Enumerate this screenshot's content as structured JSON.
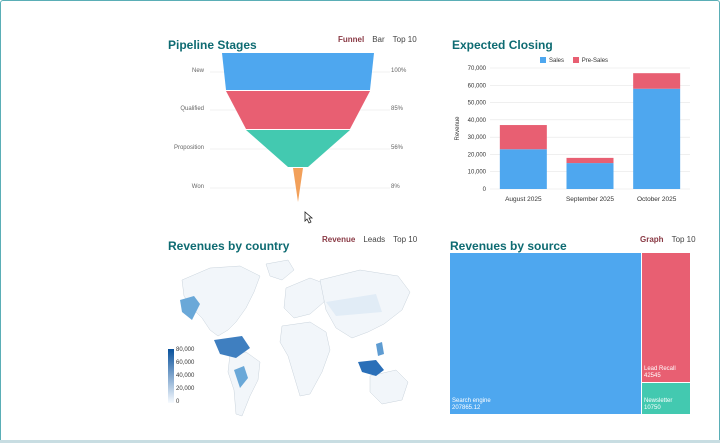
{
  "funnel": {
    "title": "Pipeline Stages",
    "tabs": [
      "Funnel",
      "Bar",
      "Top 10"
    ],
    "active_tab": "Funnel",
    "stages": [
      {
        "label": "New",
        "pct": "100%",
        "value": 100,
        "color": "#4ea7ef"
      },
      {
        "label": "Qualified",
        "pct": "85%",
        "value": 85,
        "color": "#e85f72"
      },
      {
        "label": "Proposition",
        "pct": "56%",
        "value": 56,
        "color": "#43c9b0"
      },
      {
        "label": "Won",
        "pct": "8%",
        "value": 8,
        "color": "#f2a05a"
      }
    ]
  },
  "closing": {
    "title": "Expected Closing",
    "chart_data": {
      "type": "bar",
      "stacked": true,
      "categories": [
        "August 2025",
        "September 2025",
        "October 2025"
      ],
      "series": [
        {
          "name": "Sales",
          "values": [
            23000,
            15000,
            58000
          ],
          "color": "#4ea7ef"
        },
        {
          "name": "Pre-Sales",
          "values": [
            14000,
            3000,
            9000
          ],
          "color": "#e85f72"
        }
      ],
      "ylabel": "Revenue",
      "ylim": [
        0,
        70000
      ],
      "yticks": [
        "0",
        "10,000",
        "20,000",
        "30,000",
        "40,000",
        "50,000",
        "60,000",
        "70,000"
      ],
      "legend": "top"
    }
  },
  "country": {
    "title": "Revenues by country",
    "tabs": [
      "Revenue",
      "Leads",
      "Top 10"
    ],
    "active_tab": "Revenue",
    "scale": [
      "80,000",
      "60,000",
      "40,000",
      "20,000",
      "0"
    ]
  },
  "source": {
    "title": "Revenues by source",
    "tabs": [
      "Graph",
      "Top 10"
    ],
    "active_tab": "Graph",
    "items": [
      {
        "name": "Search engine",
        "value": "207865.12",
        "amount": 207865.12,
        "color": "#4ea7ef"
      },
      {
        "name": "Lead Recall",
        "value": "42545",
        "amount": 42545,
        "color": "#e85f72"
      },
      {
        "name": "Newsletter",
        "value": "10750",
        "amount": 10750,
        "color": "#43c9b0"
      }
    ]
  }
}
